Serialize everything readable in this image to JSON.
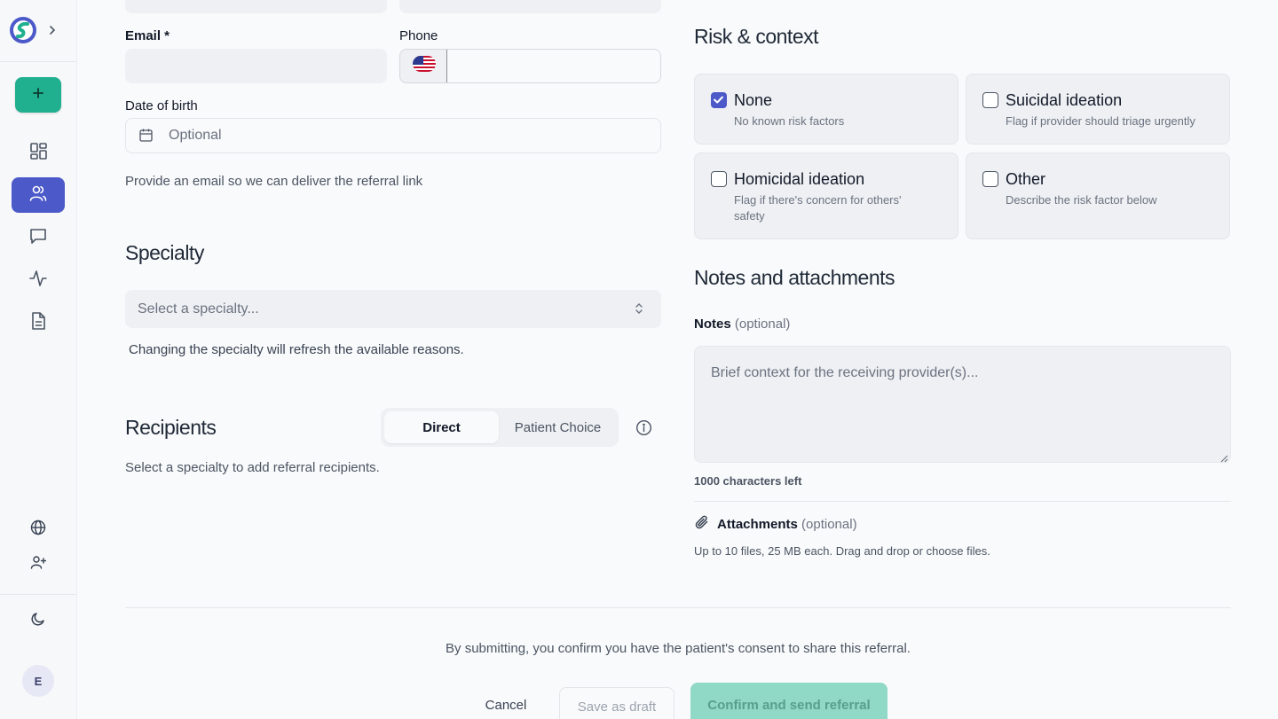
{
  "sidebar": {
    "new_icon": "plus-icon",
    "items": [
      {
        "icon": "dashboard-grid-icon",
        "active": false
      },
      {
        "icon": "users-icon",
        "active": true
      },
      {
        "icon": "message-square-icon",
        "active": false
      },
      {
        "icon": "activity-pulse-icon",
        "active": false
      },
      {
        "icon": "document-icon",
        "active": false
      }
    ],
    "bottom_icons": [
      "globe-icon",
      "user-plus-icon",
      "moon-icon"
    ],
    "avatar_initial": "E"
  },
  "patient": {
    "email_label": "Email *",
    "email_value": "",
    "phone_label": "Phone",
    "phone_value": "",
    "phone_flag": "us-flag-icon",
    "dob_label": "Date of birth",
    "dob_placeholder": "Optional",
    "email_hint": "Provide an email so we can deliver the referral link"
  },
  "specialty": {
    "title": "Specialty",
    "placeholder": "Select a specialty...",
    "hint": "Changing the specialty will refresh the available reasons."
  },
  "recipients": {
    "title": "Recipients",
    "toggle_direct": "Direct",
    "toggle_patient_choice": "Patient Choice",
    "selected": "Direct",
    "empty_text": "Select a specialty to add referral recipients."
  },
  "risk": {
    "title": "Risk & context",
    "options": [
      {
        "title": "None",
        "desc": "No known risk factors",
        "checked": true
      },
      {
        "title": "Suicidal ideation",
        "desc": "Flag if provider should triage urgently",
        "checked": false
      },
      {
        "title": "Homicidal ideation",
        "desc_line1": "Flag if there's concern for others'",
        "desc_line2": "safety",
        "checked": false
      },
      {
        "title": "Other",
        "desc": "Describe the risk factor below",
        "checked": false
      }
    ]
  },
  "notes": {
    "section_title": "Notes and attachments",
    "label": "Notes",
    "label_suffix": "(optional)",
    "placeholder": "Brief context for the receiving provider(s)...",
    "chars_left": "1000 characters left",
    "attachments_label": "Attachments",
    "attachments_suffix": "(optional)",
    "attachments_hint": "Up to 10 files, 25 MB each. Drag and drop or choose files."
  },
  "footer": {
    "consent": "By submitting, you confirm you have the patient's consent to share this referral.",
    "cancel": "Cancel",
    "save_draft": "Save as draft",
    "send": "Confirm and send referral"
  },
  "colors": {
    "accent": "#4c59c9",
    "brand_green": "#20b08f"
  }
}
